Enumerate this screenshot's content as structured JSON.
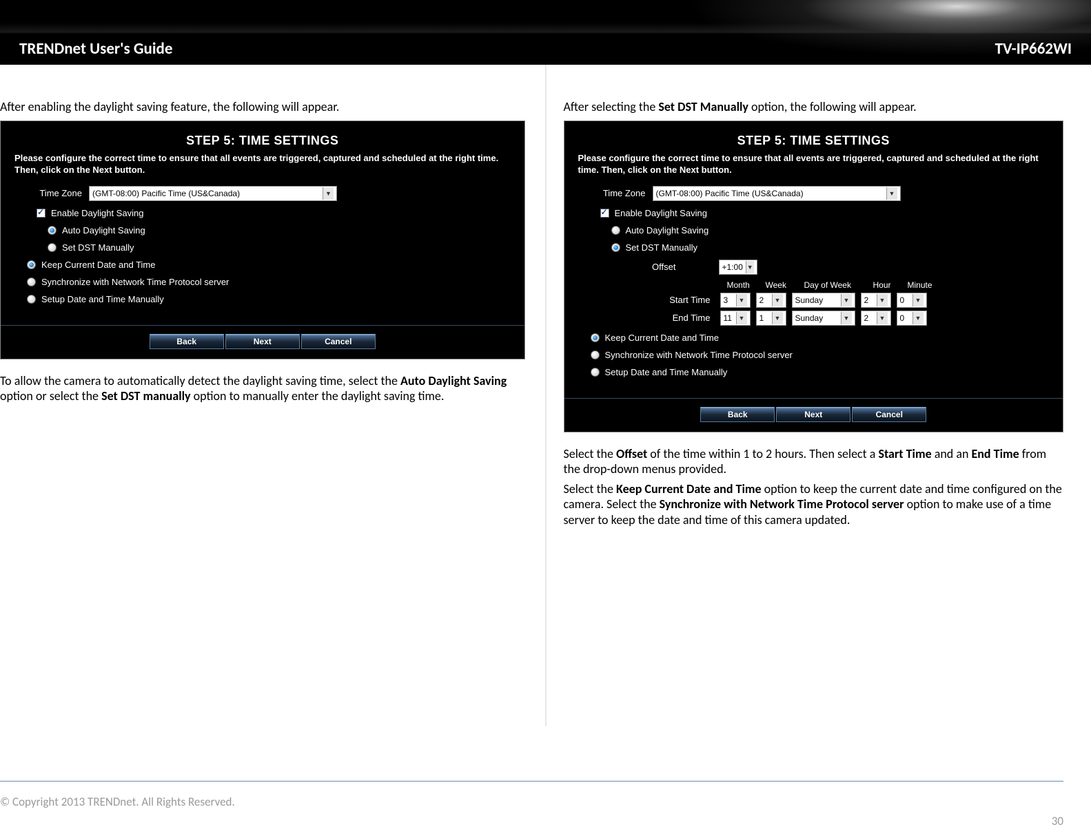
{
  "header": {
    "title": "TRENDnet User's Guide",
    "model": "TV-IP662WI"
  },
  "left": {
    "intro": "After enabling the daylight saving feature, the following will appear.",
    "panel": {
      "step_title": "STEP 5: TIME SETTINGS",
      "step_desc": "Please configure the correct time to ensure that all events are triggered, captured and scheduled at the right time. Then, click on the Next button.",
      "tz_label": "Time Zone",
      "tz_value": "(GMT-08:00) Pacific Time (US&Canada)",
      "enable_ds": "Enable Daylight Saving",
      "auto_ds": "Auto Daylight Saving",
      "set_dst": "Set DST Manually",
      "keep": "Keep Current Date and Time",
      "sync": "Synchronize with Network Time Protocol server",
      "manual": "Setup Date and Time Manually",
      "back": "Back",
      "next": "Next",
      "cancel": "Cancel"
    },
    "para2_pre": "To allow the camera to automatically detect the daylight saving time, select the ",
    "para2_b1": "Auto Daylight Saving",
    "para2_mid": " option or select the ",
    "para2_b2": "Set DST manually",
    "para2_post": " option to manually enter the daylight saving time."
  },
  "right": {
    "intro_pre": "After selecting the ",
    "intro_b": "Set DST Manually",
    "intro_post": " option, the following will appear.",
    "panel": {
      "step_title": "STEP 5: TIME SETTINGS",
      "step_desc": "Please configure the correct time to ensure that all events are triggered, captured and scheduled at the right time. Then, click on the Next button.",
      "tz_label": "Time Zone",
      "tz_value": "(GMT-08:00) Pacific Time (US&Canada)",
      "enable_ds": "Enable Daylight Saving",
      "auto_ds": "Auto Daylight Saving",
      "set_dst": "Set DST Manually",
      "offset_label": "Offset",
      "offset_value": "+1:00",
      "hd_month": "Month",
      "hd_week": "Week",
      "hd_dow": "Day of Week",
      "hd_hour": "Hour",
      "hd_min": "Minute",
      "start_label": "Start Time",
      "end_label": "End Time",
      "start": {
        "month": "3",
        "week": "2",
        "dow": "Sunday",
        "hour": "2",
        "min": "0"
      },
      "end": {
        "month": "11",
        "week": "1",
        "dow": "Sunday",
        "hour": "2",
        "min": "0"
      },
      "keep": "Keep Current Date and Time",
      "sync": "Synchronize with Network Time Protocol server",
      "manual": "Setup Date and Time Manually",
      "back": "Back",
      "next": "Next",
      "cancel": "Cancel"
    },
    "p2_a": "Select the ",
    "p2_b1": "Offset",
    "p2_b": " of the time within 1 to 2 hours. Then select a ",
    "p2_b2": "Start Time",
    "p2_c": " and an ",
    "p2_b3": "End Time",
    "p2_d": " from the drop-down menus provided.",
    "p3_a": "Select the ",
    "p3_b1": "Keep Current Date and Time",
    "p3_b": " option to keep the current date and time configured on the camera. Select the ",
    "p3_b2": "Synchronize with Network Time Protocol server",
    "p3_c": " option to make use of a time server to keep the date and time of this camera updated."
  },
  "footer": {
    "copy": "© Copyright 2013 TRENDnet. All Rights Reserved.",
    "page": "30"
  }
}
